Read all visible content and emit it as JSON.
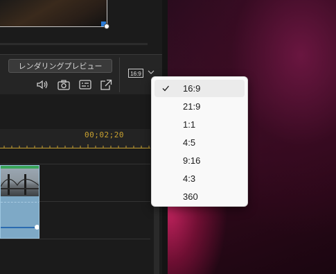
{
  "editor": {
    "render_preview_label": "レンダリングプレビュー",
    "timecode": "00;02;20",
    "aspect_badge": "16:9",
    "icons": [
      "speaker-icon",
      "camera-icon",
      "subtitles-icon",
      "external-icon",
      "chevron-down-icon"
    ]
  },
  "aspect_menu": {
    "items": [
      {
        "label": "16:9",
        "selected": true
      },
      {
        "label": "21:9",
        "selected": false
      },
      {
        "label": "1:1",
        "selected": false
      },
      {
        "label": "4:5",
        "selected": false
      },
      {
        "label": "9:16",
        "selected": false
      },
      {
        "label": "4:3",
        "selected": false
      },
      {
        "label": "360",
        "selected": false
      }
    ]
  },
  "colors": {
    "timecode": "#c9a230",
    "menu_bg": "#f9f9f9",
    "clip": "#7ea9c6",
    "clip_top": "#3aa55a"
  }
}
